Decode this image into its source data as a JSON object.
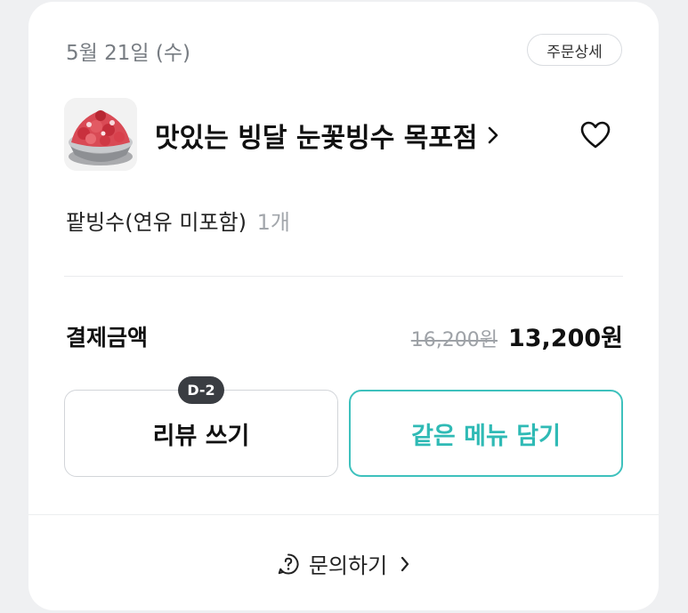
{
  "order": {
    "date": "5월 21일 (수)",
    "detail_button": "주문상세"
  },
  "store": {
    "name": "맛있는 빙달 눈꽃빙수 목포점",
    "thumbnail_icon": "strawberry-bingsu-image",
    "favorite_icon": "heart-outline-icon"
  },
  "item": {
    "name": "팥빙수(연유 미포함)",
    "quantity": "1개"
  },
  "payment": {
    "label": "결제금액",
    "original_price": "16,200원",
    "final_price": "13,200원"
  },
  "actions": {
    "review_label": "리뷰 쓰기",
    "review_badge": "D-2",
    "reorder_label": "같은 메뉴 담기"
  },
  "footer": {
    "inquiry_label": "문의하기",
    "inquiry_icon": "question-circle-icon"
  },
  "colors": {
    "accent": "#2fbab5",
    "badge_bg": "#3a3d42"
  }
}
